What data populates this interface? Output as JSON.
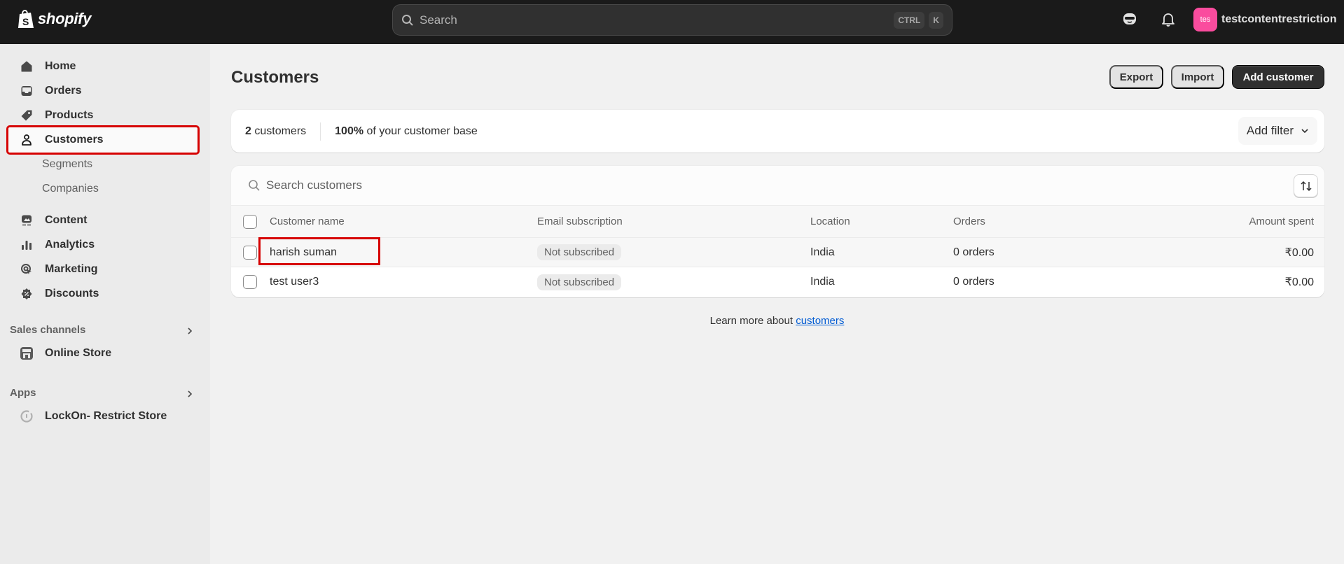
{
  "topbar": {
    "brand": "shopify",
    "search_placeholder": "Search",
    "shortcut_keys": [
      "CTRL",
      "K"
    ],
    "store_avatar_text": "tes",
    "store_name": "testcontentrestriction",
    "colors": {
      "bar": "#1a1a1a",
      "avatar": "#fa4c9e"
    }
  },
  "sidebar": {
    "items": [
      {
        "label": "Home",
        "icon": "home-icon"
      },
      {
        "label": "Orders",
        "icon": "inbox-icon"
      },
      {
        "label": "Products",
        "icon": "tag-icon"
      },
      {
        "label": "Customers",
        "icon": "person-icon",
        "active": true
      },
      {
        "label": "Content",
        "icon": "image-icon"
      },
      {
        "label": "Analytics",
        "icon": "bar-chart-icon"
      },
      {
        "label": "Marketing",
        "icon": "target-icon"
      },
      {
        "label": "Discounts",
        "icon": "discount-icon"
      }
    ],
    "customers_sub": [
      "Segments",
      "Companies"
    ],
    "sales_channels": {
      "label": "Sales channels",
      "items": [
        {
          "label": "Online Store",
          "icon": "store-icon"
        }
      ]
    },
    "apps": {
      "label": "Apps",
      "items": [
        {
          "label": "LockOn- Restrict Store",
          "icon": "app-icon"
        }
      ]
    }
  },
  "main": {
    "title": "Customers",
    "buttons": {
      "export": "Export",
      "import": "Import",
      "add_customer": "Add customer"
    },
    "summary": {
      "count_num": "2",
      "count_text": " customers",
      "pct_num": "100%",
      "pct_text": " of your customer base",
      "add_filter": "Add filter"
    },
    "table": {
      "search_placeholder": "Search customers",
      "columns": [
        "Customer name",
        "Email subscription",
        "Location",
        "Orders",
        "Amount spent"
      ],
      "rows": [
        {
          "name": "harish suman",
          "email": "Not subscribed",
          "location": "India",
          "orders": "0 orders",
          "amount": "₹0.00"
        },
        {
          "name": "test user3",
          "email": "Not subscribed",
          "location": "India",
          "orders": "0 orders",
          "amount": "₹0.00"
        }
      ]
    },
    "learn_more": {
      "text": "Learn more about ",
      "link": "customers"
    }
  }
}
